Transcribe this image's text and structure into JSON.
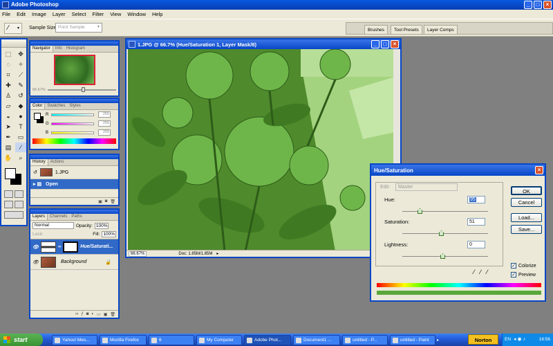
{
  "app": {
    "title": "Adobe Photoshop"
  },
  "menu": [
    "File",
    "Edit",
    "Image",
    "Layer",
    "Select",
    "Filter",
    "View",
    "Window",
    "Help"
  ],
  "options": {
    "sample_size_label": "Sample Size:",
    "sample_size_value": "Point Sample"
  },
  "palette_well": {
    "tabs": [
      "Brushes",
      "Tool Presets",
      "Layer Comps"
    ]
  },
  "navigator": {
    "tabs": [
      "Navigator",
      "Info",
      "Histogram"
    ],
    "zoom": "66.67%"
  },
  "color": {
    "tabs": [
      "Color",
      "Swatches",
      "Styles"
    ],
    "channels": [
      {
        "label": "R",
        "value": "255"
      },
      {
        "label": "G",
        "value": "255"
      },
      {
        "label": "B",
        "value": "255"
      }
    ]
  },
  "history": {
    "tabs": [
      "History",
      "Actions"
    ],
    "items": [
      "1.JPG",
      "Open"
    ]
  },
  "layers": {
    "tabs": [
      "Layers",
      "Channels",
      "Paths"
    ],
    "blend_mode": "Normal",
    "opacity_label": "Opacity:",
    "opacity": "100%",
    "lock_label": "Lock:",
    "fill_label": "Fill:",
    "fill": "100%",
    "items": [
      "Hue/Saturati...",
      "Background"
    ]
  },
  "document": {
    "title": "1.JPG @ 66.7% (Hue/Saturation 1, Layer Mask/8)",
    "zoom": "66.67%",
    "doc_info": "Doc: 1.85M/1.85M"
  },
  "hue_sat": {
    "title": "Hue/Saturation",
    "edit_label": "Edit:",
    "edit_value": "Master",
    "hue_label": "Hue:",
    "hue": "95",
    "saturation_label": "Saturation:",
    "saturation": "51",
    "lightness_label": "Lightness:",
    "lightness": "0",
    "ok": "OK",
    "cancel": "Cancel",
    "load": "Load...",
    "save": "Save...",
    "colorize": "Colorize",
    "preview": "Preview",
    "colorize_checked": true,
    "preview_checked": true
  },
  "taskbar": {
    "start": "start",
    "items": [
      "Yahoo! Mes...",
      "Mozilla Firefox",
      "6",
      "My Computer",
      "Adobe Phot...",
      "Document1 ...",
      "untitled - P...",
      "untitled - Paint"
    ],
    "norton": "Norton",
    "lang": "EN",
    "clock": "16:56"
  },
  "colors": {
    "xp_blue": "#0747c6",
    "accent_green": "#5aa83c",
    "panel_bg": "#ece9d8"
  }
}
